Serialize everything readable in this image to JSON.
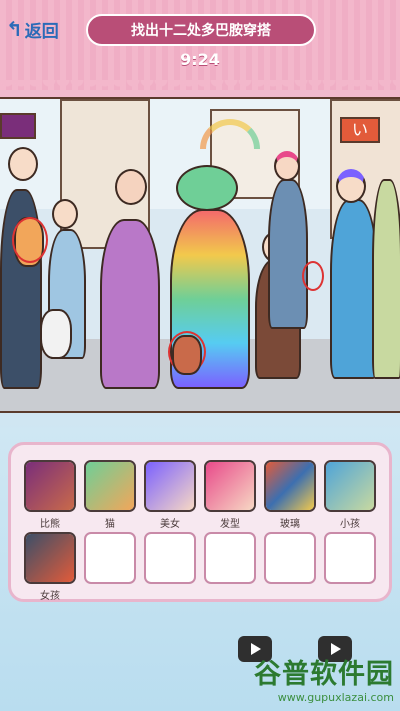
{
  "header": {
    "back_label": "返回",
    "title": "找出十二处多巴胺穿搭",
    "timer": "9:24"
  },
  "scene": {
    "sign_text": "い"
  },
  "found_items": [
    {
      "label": "比熊"
    },
    {
      "label": "猫"
    },
    {
      "label": "美女"
    },
    {
      "label": "发型"
    },
    {
      "label": "玻璃"
    },
    {
      "label": "小孩"
    },
    {
      "label": "女孩"
    }
  ],
  "empty_slots": 5,
  "watermark": {
    "brand": "谷普软件园",
    "url": "www.gupuxlazai.com"
  }
}
